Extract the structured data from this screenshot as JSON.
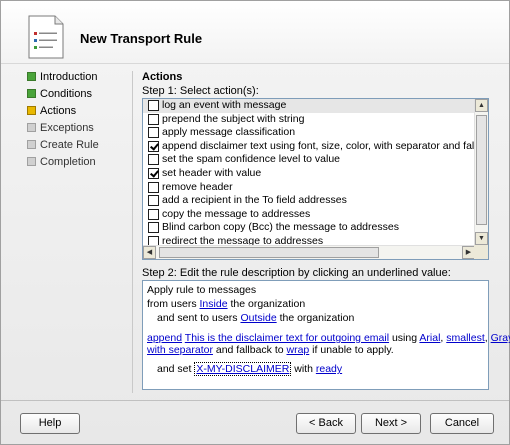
{
  "window": {
    "title": "New Transport Rule"
  },
  "wizard_steps": [
    {
      "label": "Introduction",
      "state": "done"
    },
    {
      "label": "Conditions",
      "state": "done"
    },
    {
      "label": "Actions",
      "state": "current"
    },
    {
      "label": "Exceptions",
      "state": "pending"
    },
    {
      "label": "Create Rule",
      "state": "pending"
    },
    {
      "label": "Completion",
      "state": "pending"
    }
  ],
  "main": {
    "section_title": "Actions",
    "step1_label": "Step 1: Select action(s):",
    "step2_label": "Step 2: Edit the rule description by clicking an underlined value:"
  },
  "actions": [
    {
      "label": "log an event with message",
      "checked": false,
      "selected": true
    },
    {
      "label": "prepend the subject with string",
      "checked": false,
      "selected": false
    },
    {
      "label": "apply message classification",
      "checked": false,
      "selected": false
    },
    {
      "label": "append disclaimer text using font, size, color, with separator and fallback to action i",
      "checked": true,
      "selected": false
    },
    {
      "label": "set the spam confidence level to value",
      "checked": false,
      "selected": false
    },
    {
      "label": "set header with value",
      "checked": true,
      "selected": false
    },
    {
      "label": "remove header",
      "checked": false,
      "selected": false
    },
    {
      "label": "add a recipient in the To field addresses",
      "checked": false,
      "selected": false
    },
    {
      "label": "copy the message to addresses",
      "checked": false,
      "selected": false
    },
    {
      "label": "Blind carbon copy (Bcc) the message to addresses",
      "checked": false,
      "selected": false
    },
    {
      "label": "redirect the message to addresses",
      "checked": false,
      "selected": false
    }
  ],
  "description": {
    "line1": "Apply rule to messages",
    "line2_pre": "from users ",
    "line2_link": "Inside",
    "line2_post": " the organization",
    "line3_pre": "and sent to users ",
    "line3_link": "Outside",
    "line3_post": " the organization",
    "line4_append": "append",
    "line4_text": "This is the disclaimer text for outgoing email",
    "line4_using": " using ",
    "line4_font": "Arial",
    "line4_comma1": ", ",
    "line4_size": "smallest",
    "line4_comma2": ", ",
    "line4_color": "Gray",
    "line4_comma3": ",",
    "line5_separator": "with separator",
    "line5_mid": " and fallback to ",
    "line5_wrap": "wrap",
    "line5_post": " if unable to apply.",
    "line6_pre": "and set ",
    "line6_header": "X-MY-DISCLAIMER",
    "line6_mid": " with ",
    "line6_value": "ready"
  },
  "buttons": {
    "help": "Help",
    "back": "< Back",
    "next": "Next >",
    "cancel": "Cancel"
  },
  "colors": {
    "link": "#0000cc",
    "step_done": "#4aa43a",
    "step_current": "#e8b800",
    "step_pending": "#d0d0d0"
  }
}
